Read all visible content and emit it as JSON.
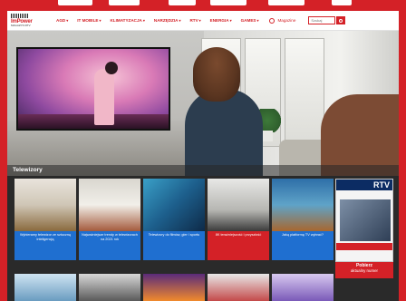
{
  "header": {
    "logo_text": "ImPower",
    "logo_sub": "MAGAZYN RTV",
    "nav": [
      {
        "label": "AGD"
      },
      {
        "label": "IT MOBILE"
      },
      {
        "label": "KLIMATYZACJA"
      },
      {
        "label": "NARZĘDZIA"
      },
      {
        "label": "RTV"
      },
      {
        "label": "ENERGIA"
      },
      {
        "label": "GAMES"
      }
    ],
    "magazines_label": "Magazine",
    "search_placeholder": "Szukaj"
  },
  "section": {
    "title": "Telewizory"
  },
  "cards": [
    {
      "caption": "Wybieramy telewizor ze sztuczną inteligencją"
    },
    {
      "caption": "Najważniejsze trendy w telewizorach na 2021 rok"
    },
    {
      "caption": "Telewizory do filmów, gier i sportu"
    },
    {
      "caption": "8K teraźniejszość i przyszłość"
    },
    {
      "caption": "Jaką platformę TV wybrać?"
    }
  ],
  "magazine": {
    "masthead": "RTV",
    "download_label": "Pobierz",
    "download_sub": "aktualny numer"
  },
  "colors": {
    "brand": "#d42127",
    "caption_blue": "#1f6fd0"
  }
}
